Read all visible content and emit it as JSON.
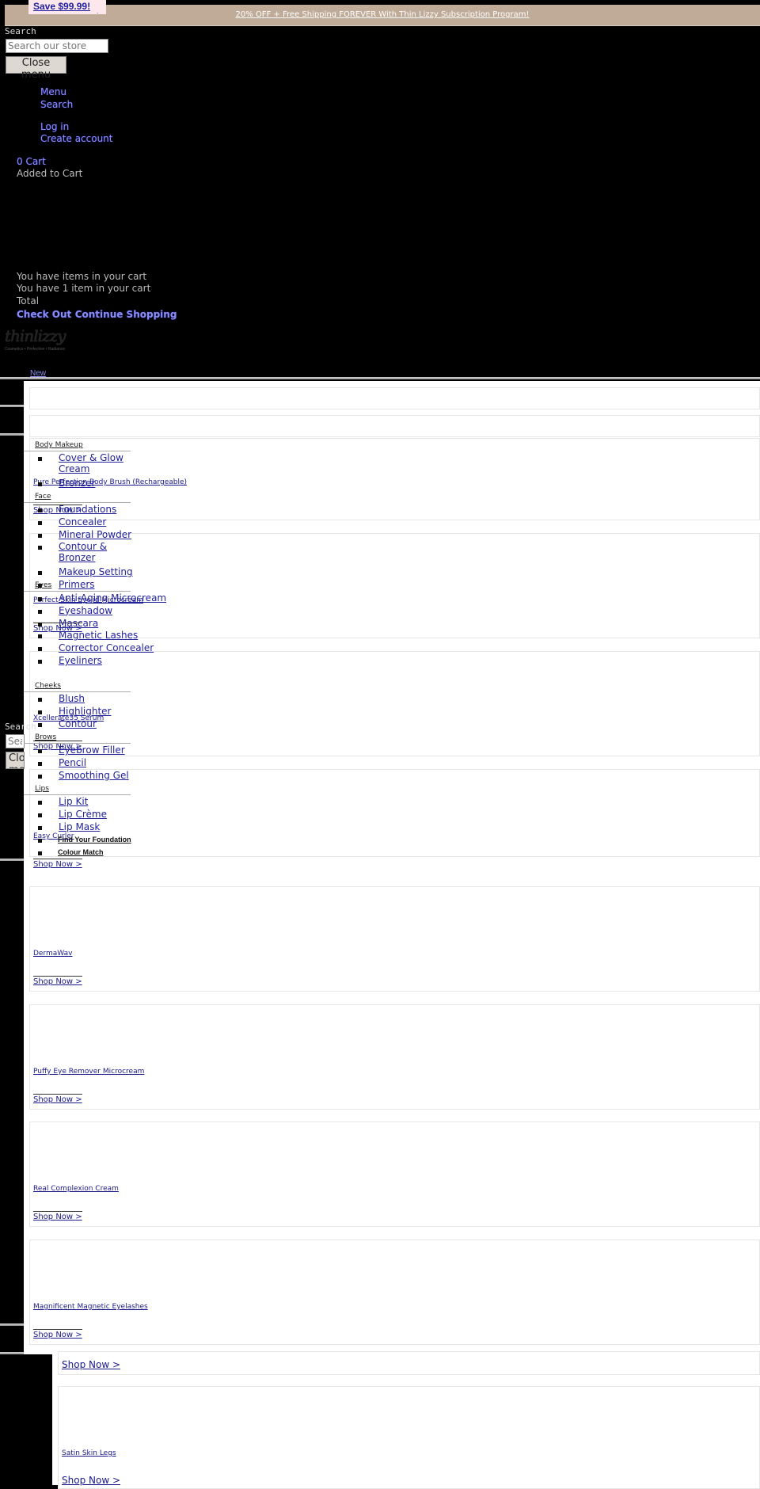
{
  "announcement": {
    "save_badge": "Save $99.99!",
    "promo_text": "20% OFF + Free Shipping FOREVER With Thin Lizzy Subscription Program!"
  },
  "search": {
    "label": "Search",
    "placeholder": "Search our store",
    "close_menu": "Close menu"
  },
  "header_links": {
    "menu": "Menu",
    "search": "Search",
    "log_in": "Log in",
    "create_account": "Create account",
    "cart": "0 Cart",
    "added_to_cart": "Added to Cart"
  },
  "cart_drawer": {
    "items_text": "You have items in your cart",
    "one_item_text": "You have 1 item in your cart",
    "total_label": "Total",
    "check_out": "Check Out",
    "continue_shopping": "Continue Shopping"
  },
  "logo": {
    "name": "thinlizzy",
    "tagline": "Cosmetics • Perfection • Radiance"
  },
  "nav": {
    "new_label": "New"
  },
  "mega_menu": {
    "categories": [
      {
        "title": "Body Makeup",
        "items": [
          "Cover & Glow Cream",
          "Bronzer"
        ]
      },
      {
        "title": "Face",
        "items": [
          "Foundations",
          "Concealer",
          "Mineral Powder",
          "Contour & Bronzer",
          "Makeup Setting",
          "Primers"
        ]
      },
      {
        "title": "Eyes",
        "items": [
          "Anti-Aging Microcream",
          "Eyeshadow",
          "Mascara",
          "Magnetic Lashes",
          "Corrector Concealer",
          "Eyeliners"
        ]
      },
      {
        "title": "Cheeks",
        "items": [
          "Blush",
          "Highlighter",
          "Contour"
        ]
      },
      {
        "title": "Brows",
        "items": [
          "Eyebrow Filler",
          "Pencil",
          "Smoothing Gel"
        ]
      },
      {
        "title": "Lips",
        "items": [
          "Lip Kit",
          "Lip Crème",
          "Lip Mask"
        ]
      }
    ],
    "extras": [
      "Find Your Foundation",
      "Colour Match"
    ]
  },
  "products": [
    {
      "name": "Pure Perfection Body Brush (Rechargeable)",
      "cta": "Shop Now >"
    },
    {
      "name": "Perfect Skin Eyelid Microcream",
      "cta": "Shop Now >"
    },
    {
      "name": "Xcellerate35 Serum",
      "cta": "Shop Now >"
    },
    {
      "name": "Easy Curler",
      "cta": "Shop Now >"
    },
    {
      "name": "DermaWav",
      "cta": "Shop Now >"
    },
    {
      "name": "Puffy Eye Remover Microcream",
      "cta": "Shop Now >"
    },
    {
      "name": "Real Complexion Cream",
      "cta": "Shop Now >"
    },
    {
      "name": "Magnificent Magnetic Eyelashes",
      "cta": "Shop Now >"
    }
  ],
  "lower_section": {
    "top_cta": "Shop Now >",
    "product_name": "Satin Skin Legs",
    "product_cta": "Shop Now >"
  },
  "ghost_search": {
    "label": "Search",
    "placeholder": "Search our store",
    "close_menu": "Close menu"
  }
}
